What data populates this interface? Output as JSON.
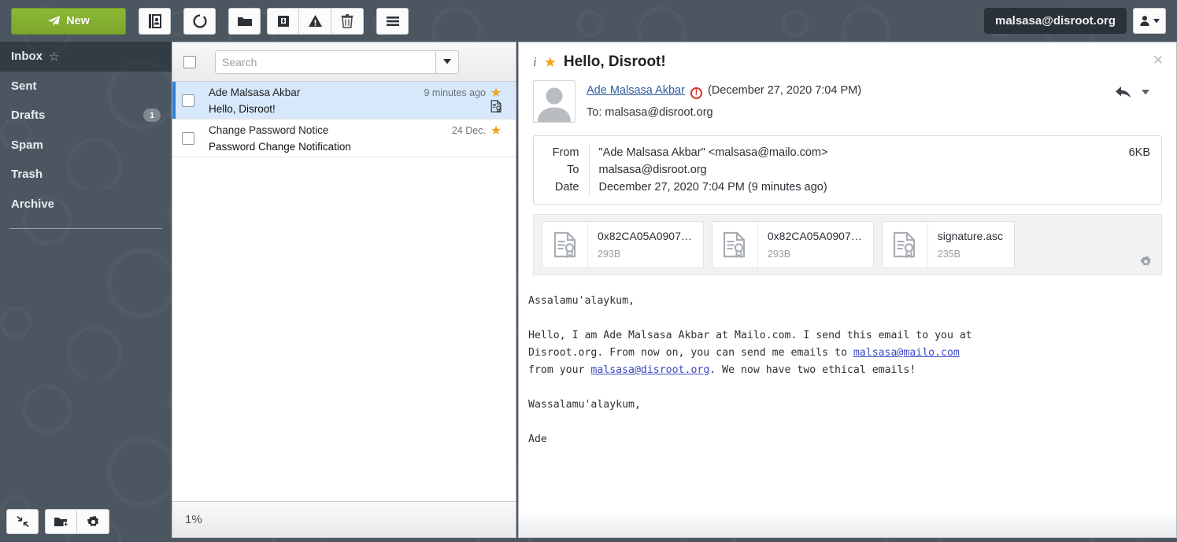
{
  "toolbar": {
    "new_label": "New",
    "buttons": [
      {
        "name": "contacts",
        "icon": "address-book-icon"
      },
      {
        "name": "refresh",
        "icon": "refresh-circle-icon"
      },
      {
        "name": "folder",
        "icon": "folder-icon"
      },
      {
        "name": "archive",
        "icon": "archive-box-icon"
      },
      {
        "name": "spam",
        "icon": "warning-triangle-icon"
      },
      {
        "name": "delete",
        "icon": "trash-icon"
      },
      {
        "name": "more",
        "icon": "hamburger-menu-icon"
      }
    ],
    "account_email": "malsasa@disroot.org",
    "account_menu_icon": "user-icon"
  },
  "sidebar": {
    "items": [
      {
        "label": "Inbox",
        "badge": "",
        "active": true,
        "starred": true
      },
      {
        "label": "Sent",
        "badge": "",
        "active": false,
        "starred": false
      },
      {
        "label": "Drafts",
        "badge": "1",
        "active": false,
        "starred": false
      },
      {
        "label": "Spam",
        "badge": "",
        "active": false,
        "starred": false
      },
      {
        "label": "Trash",
        "badge": "",
        "active": false,
        "starred": false
      },
      {
        "label": "Archive",
        "badge": "",
        "active": false,
        "starred": false
      }
    ],
    "footer_buttons": [
      {
        "name": "collapse",
        "icon": "collapse-arrows-icon"
      },
      {
        "name": "add-folder",
        "icon": "add-folder-icon"
      },
      {
        "name": "folder-settings",
        "icon": "gear-icon"
      }
    ]
  },
  "list": {
    "select_all_icon": "checkbox-icon",
    "search_placeholder": "Search",
    "search_value": "",
    "search_dropdown_icon": "chevron-down-icon",
    "messages": [
      {
        "from": "Ade Malsasa Akbar",
        "date": "9 minutes ago",
        "subject": "Hello, Disroot!",
        "flagged": true,
        "signed": true,
        "selected": true
      },
      {
        "from": "Change Password Notice",
        "date": "24 Dec.",
        "subject": "Password Change Notification",
        "flagged": true,
        "signed": false,
        "selected": false
      }
    ],
    "status": "1%"
  },
  "message": {
    "info_icon": "info-icon",
    "flag_icon": "star-icon",
    "subject": "Hello, Disroot!",
    "close_icon": "close-icon",
    "reply_icon": "reply-arrow-icon",
    "reply_dropdown_icon": "chevron-down-icon",
    "avatar_icon": "avatar-icon",
    "sender_name": "Ade Malsasa Akbar",
    "signature_warning_icon": "signature-invalid-icon",
    "sent_parenthetical": "(December 27, 2020 7:04 PM)",
    "to_summary": "To: malsasa@disroot.org",
    "details": {
      "labels": {
        "from": "From",
        "to": "To",
        "date": "Date"
      },
      "from": "\"Ade Malsasa Akbar\" <malsasa@mailo.com>",
      "to": "malsasa@disroot.org",
      "date": "December 27, 2020 7:04 PM (9 minutes ago)",
      "size": "6KB"
    },
    "attachments": [
      {
        "name": "0x82CA05A0907…",
        "size": "293B",
        "icon": "certificate-file-icon"
      },
      {
        "name": "0x82CA05A0907…",
        "size": "293B",
        "icon": "certificate-file-icon"
      },
      {
        "name": "signature.asc",
        "size": "235B",
        "icon": "certificate-file-icon"
      }
    ],
    "attachment_settings_icon": "gear-icon",
    "body": {
      "greeting": "Assalamu'alaykum,",
      "para_part1": "Hello, I am Ade Malsasa Akbar at Mailo.com. I send this email to you at\nDisroot.org. From now on, you can send me emails to ",
      "link1": "malsasa@mailo.com",
      "para_part2": "\nfrom your ",
      "link2": "malsasa@disroot.org",
      "para_part3": ". We now have two ethical emails!",
      "closing": "Wassalamu'alaykum,",
      "signoff": "Ade"
    }
  },
  "colors": {
    "accent_green": "#8cb935",
    "selection_blue": "#d7e8fb",
    "selection_bar": "#2a7fd4",
    "star_gold": "#f0a21c",
    "sidebar_bg": "#4b5661",
    "warning_red": "#d93025"
  }
}
